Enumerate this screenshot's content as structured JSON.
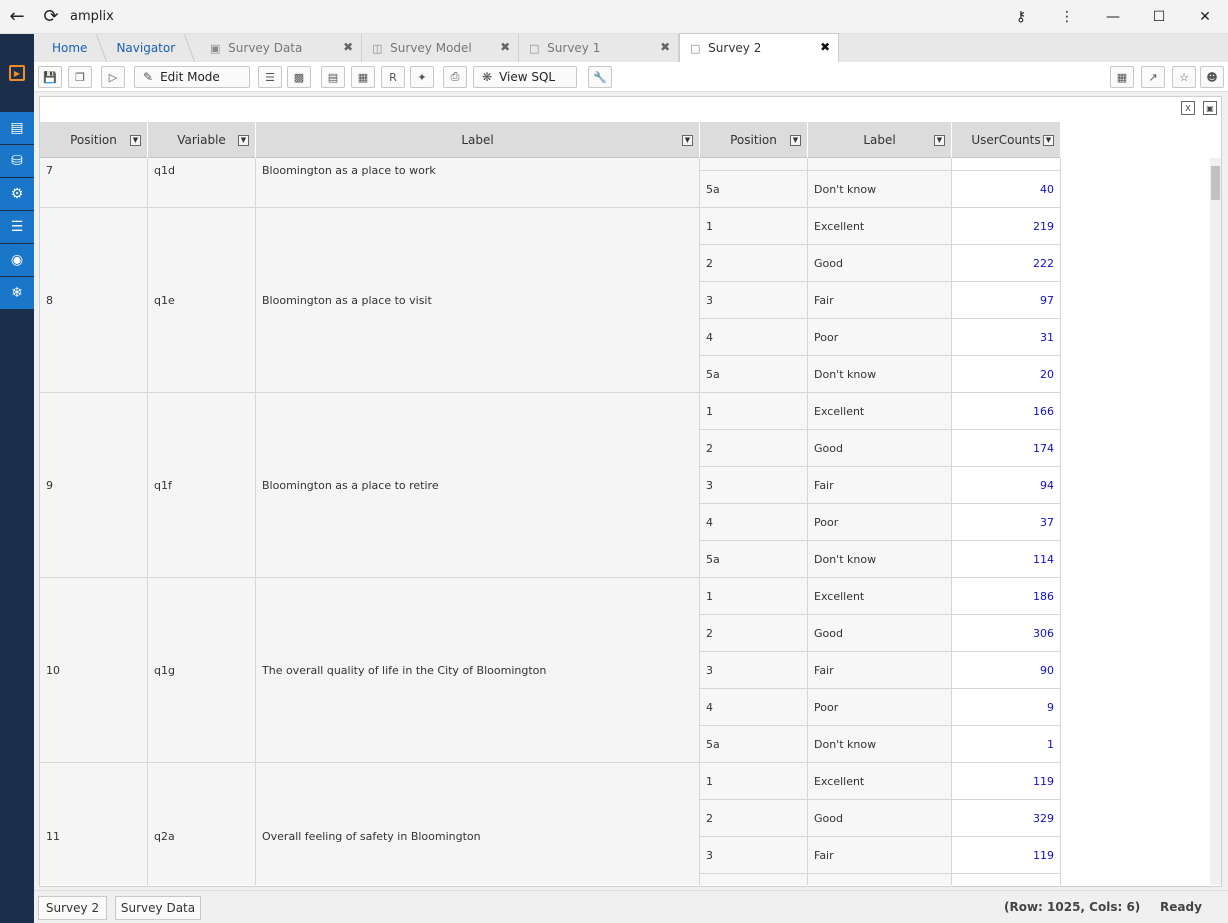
{
  "window": {
    "title": "amplix"
  },
  "tabs": {
    "home": "Home",
    "navigator": "Navigator",
    "items": [
      {
        "label": "Survey Data",
        "icon": "cube-icon"
      },
      {
        "label": "Survey Model",
        "icon": "model-icon"
      },
      {
        "label": "Survey 1",
        "icon": "document-icon"
      },
      {
        "label": "Survey 2",
        "icon": "document-icon",
        "active": true
      }
    ],
    "close_glyph": "✖"
  },
  "toolbar": {
    "edit_mode": "Edit Mode",
    "view_sql": "View SQL"
  },
  "grid": {
    "columns": [
      "Position",
      "Variable",
      "Label",
      "Position",
      "Label",
      "UserCounts"
    ],
    "groups": [
      {
        "position": "7",
        "variable": "q1d",
        "label": "Bloomington as a place to work",
        "rows": [
          {
            "pos": "",
            "label": "",
            "count": ""
          },
          {
            "pos": "5a",
            "label": "Don't know",
            "count": "40"
          }
        ]
      },
      {
        "position": "8",
        "variable": "q1e",
        "label": "Bloomington as a place to visit",
        "rows": [
          {
            "pos": "1",
            "label": "Excellent",
            "count": "219"
          },
          {
            "pos": "2",
            "label": "Good",
            "count": "222"
          },
          {
            "pos": "3",
            "label": "Fair",
            "count": "97"
          },
          {
            "pos": "4",
            "label": "Poor",
            "count": "31"
          },
          {
            "pos": "5a",
            "label": "Don't know",
            "count": "20"
          }
        ]
      },
      {
        "position": "9",
        "variable": "q1f",
        "label": "Bloomington as a place to retire",
        "rows": [
          {
            "pos": "1",
            "label": "Excellent",
            "count": "166"
          },
          {
            "pos": "2",
            "label": "Good",
            "count": "174"
          },
          {
            "pos": "3",
            "label": "Fair",
            "count": "94"
          },
          {
            "pos": "4",
            "label": "Poor",
            "count": "37"
          },
          {
            "pos": "5a",
            "label": "Don't know",
            "count": "114"
          }
        ]
      },
      {
        "position": "10",
        "variable": "q1g",
        "label": "The overall quality of life in the City of Bloomington",
        "rows": [
          {
            "pos": "1",
            "label": "Excellent",
            "count": "186"
          },
          {
            "pos": "2",
            "label": "Good",
            "count": "306"
          },
          {
            "pos": "3",
            "label": "Fair",
            "count": "90"
          },
          {
            "pos": "4",
            "label": "Poor",
            "count": "9"
          },
          {
            "pos": "5a",
            "label": "Don't know",
            "count": "1"
          }
        ]
      },
      {
        "position": "11",
        "variable": "q2a",
        "label": "Overall feeling of safety in Bloomington",
        "rows": [
          {
            "pos": "1",
            "label": "Excellent",
            "count": "119"
          },
          {
            "pos": "2",
            "label": "Good",
            "count": "329"
          },
          {
            "pos": "3",
            "label": "Fair",
            "count": "119"
          },
          {
            "pos": "",
            "label": "",
            "count": ""
          }
        ]
      }
    ]
  },
  "bottom": {
    "tabs": [
      "Survey 2",
      "Survey Data"
    ],
    "row_col": "(Row: 1025, Cols: 6)",
    "status": "Ready"
  }
}
